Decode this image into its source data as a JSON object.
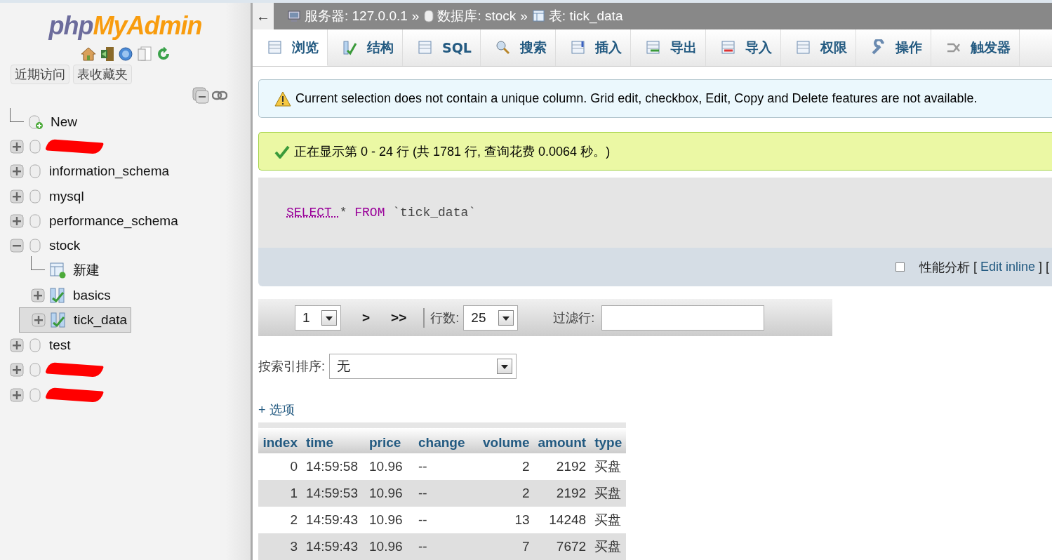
{
  "sidebar": {
    "logo": {
      "php": "php",
      "my_admin": "MyAdmin"
    },
    "buttons": [
      "近期访问",
      "表收藏夹"
    ],
    "tree": [
      {
        "kind": "new",
        "name": "New"
      },
      {
        "kind": "database",
        "redacted": true,
        "expanded": false
      },
      {
        "kind": "database",
        "name": "information_schema",
        "expanded": false
      },
      {
        "kind": "database",
        "name": "mysql",
        "expanded": false
      },
      {
        "kind": "database",
        "name": "performance_schema",
        "expanded": false
      },
      {
        "kind": "database",
        "name": "stock",
        "expanded": true,
        "children": [
          {
            "kind": "new_table",
            "name": "新建"
          },
          {
            "kind": "table",
            "name": "basics",
            "expanded": false,
            "selected": false
          },
          {
            "kind": "table",
            "name": "tick_data",
            "expanded": false,
            "selected": true
          }
        ]
      },
      {
        "kind": "database",
        "name": "test",
        "expanded": false
      },
      {
        "kind": "database",
        "redacted": true,
        "expanded": false
      },
      {
        "kind": "database",
        "redacted": true,
        "expanded": false
      }
    ]
  },
  "breadcrumb": {
    "back": "←",
    "items": [
      {
        "kind": "server",
        "text": "服务器: 127.0.0.1"
      },
      {
        "kind": "database",
        "text": "数据库: stock"
      },
      {
        "kind": "table",
        "text": "表: tick_data"
      }
    ],
    "separator": "»"
  },
  "tabs": [
    {
      "label": "浏览",
      "selected": true
    },
    {
      "label": "结构",
      "selected": false
    },
    {
      "label": "SQL",
      "selected": false
    },
    {
      "label": "搜索",
      "selected": false
    },
    {
      "label": "插入",
      "selected": false
    },
    {
      "label": "导出",
      "selected": false
    },
    {
      "label": "导入",
      "selected": false
    },
    {
      "label": "权限",
      "selected": false
    },
    {
      "label": "操作",
      "selected": false
    },
    {
      "label": "触发器",
      "selected": false
    }
  ],
  "messages": [
    {
      "kind": "warning",
      "text": "Current selection does not contain a unique column. Grid edit, checkbox, Edit, Copy and Delete features are not available."
    },
    {
      "kind": "success",
      "text": "正在显示第 0 - 24 行 (共 1781 行, 查询花费 0.0064 秒。)"
    }
  ],
  "query": [
    {
      "kind": "keyword",
      "text": "SELECT"
    },
    {
      "kind": "plain",
      "text": "*"
    },
    {
      "kind": "keyword2",
      "text": "FROM"
    },
    {
      "kind": "name",
      "text": "`tick_data`"
    }
  ],
  "profiling": {
    "checked": false,
    "label": "性能分析",
    "open": "[",
    "link": "Edit inline",
    "close": "] ["
  },
  "pager": {
    "page": "1",
    "next": ">",
    "last": ">>",
    "rows_label": "行数:",
    "rows": "25",
    "filter_label": "过滤行:"
  },
  "sort": {
    "label": "按索引排序:",
    "value": "无"
  },
  "options": "+ 选项",
  "table": {
    "columns": [
      {
        "name": "index",
        "numeric": true
      },
      {
        "name": "time",
        "numeric": false
      },
      {
        "name": "price",
        "numeric": false
      },
      {
        "name": "change",
        "numeric": false
      },
      {
        "name": "volume",
        "numeric": true
      },
      {
        "name": "amount",
        "numeric": true
      },
      {
        "name": "type",
        "numeric": false
      }
    ],
    "rows": [
      [
        "0",
        "14:59:58",
        "10.96",
        "--",
        "2",
        "2192",
        "买盘"
      ],
      [
        "1",
        "14:59:53",
        "10.96",
        "--",
        "2",
        "2192",
        "买盘"
      ],
      [
        "2",
        "14:59:43",
        "10.96",
        "--",
        "13",
        "14248",
        "买盘"
      ],
      [
        "3",
        "14:59:43",
        "10.96",
        "--",
        "7",
        "7672",
        "买盘"
      ]
    ]
  }
}
